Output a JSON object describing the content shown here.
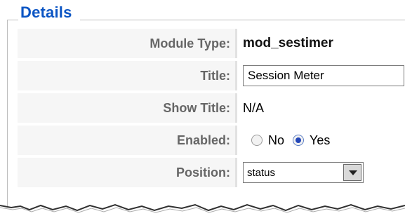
{
  "details": {
    "legend": "Details",
    "rows": [
      {
        "label": "Module Type:",
        "value": "mod_sestimer"
      },
      {
        "label": "Title:",
        "value": "Session Meter"
      },
      {
        "label": "Show Title:",
        "value": "N/A"
      },
      {
        "label": "Enabled:",
        "options": [
          "No",
          "Yes"
        ],
        "selected": "Yes"
      },
      {
        "label": "Position:",
        "value": "status"
      }
    ]
  }
}
